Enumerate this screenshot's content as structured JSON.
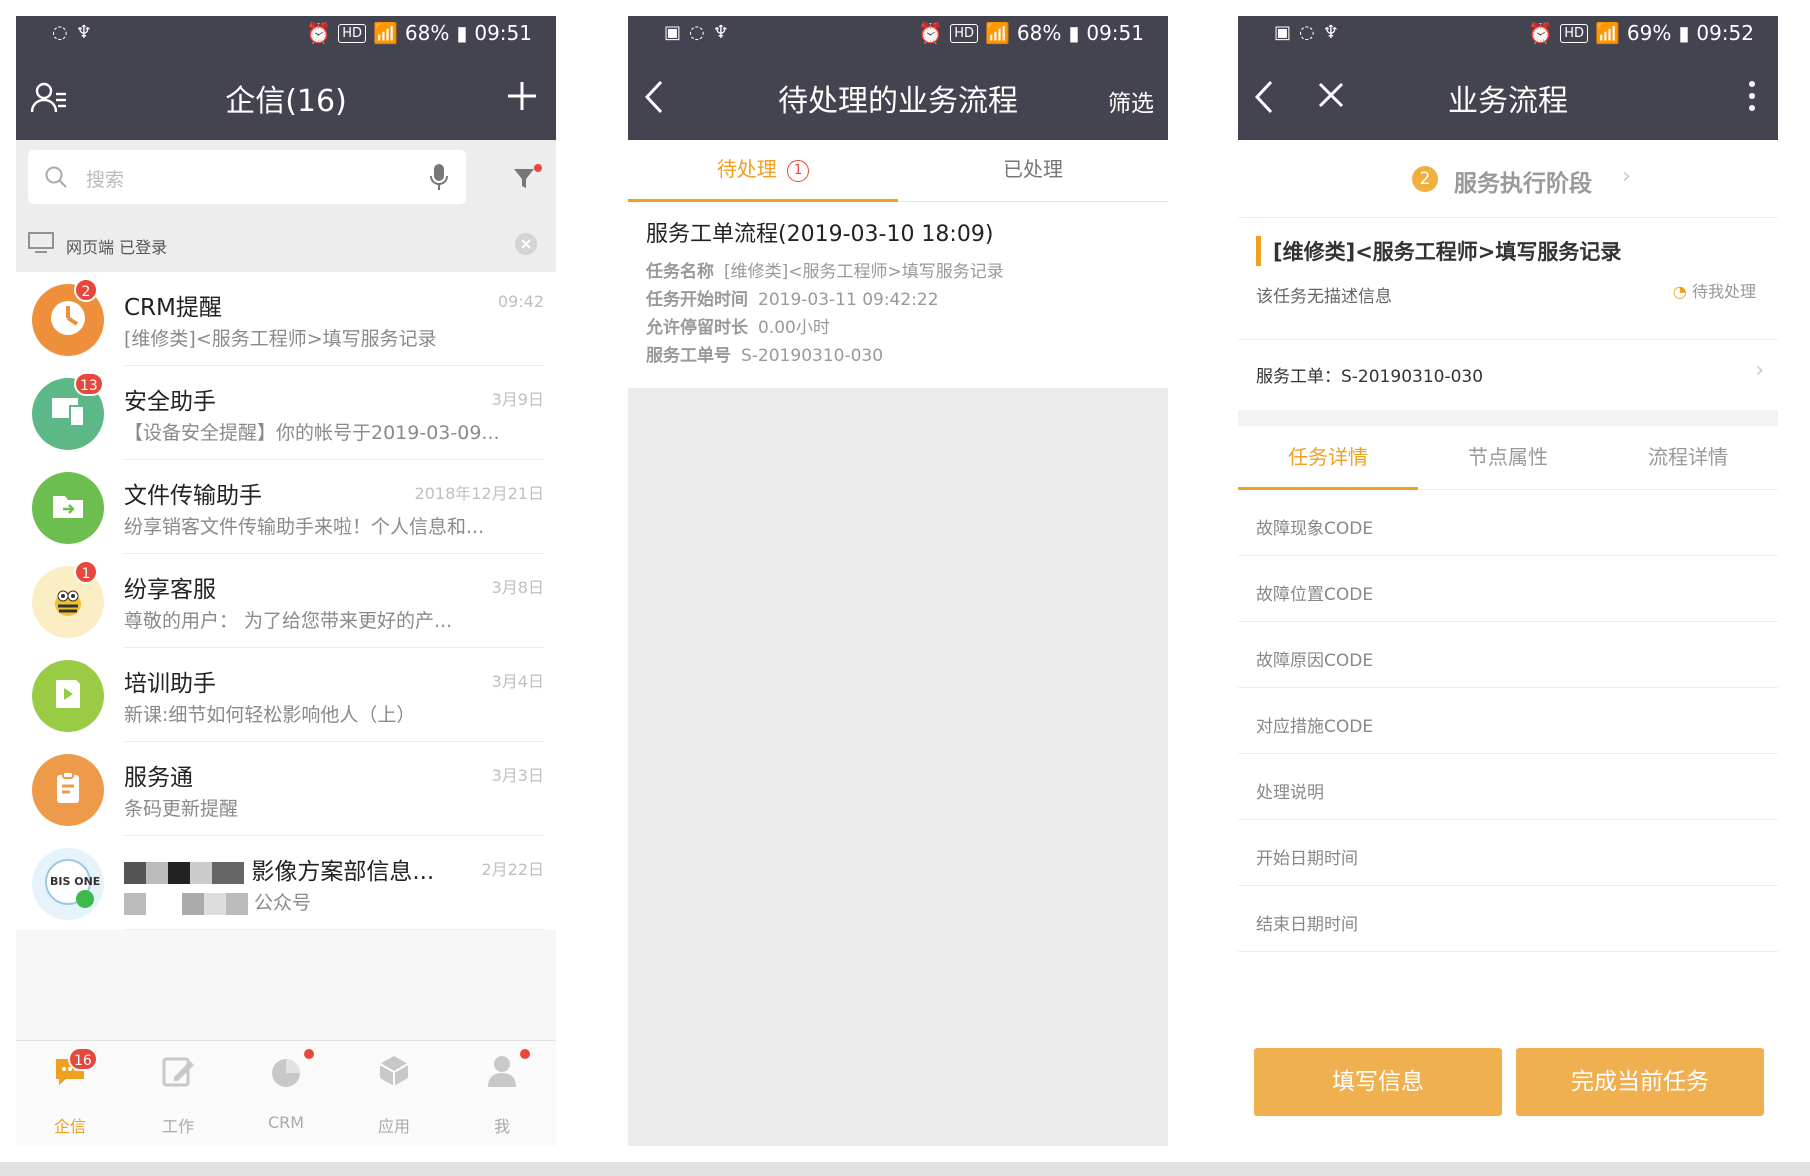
{
  "status_bars": [
    {
      "battery": "68%",
      "time": "09:51",
      "hd": "HD"
    },
    {
      "battery": "68%",
      "time": "09:51",
      "hd": "HD"
    },
    {
      "battery": "69%",
      "time": "09:52",
      "hd": "HD"
    }
  ],
  "screen1": {
    "title": "企信(16)",
    "search_placeholder": "搜索",
    "web_login": "网页端 已登录",
    "chats": [
      {
        "name": "CRM提醒",
        "time": "09:42",
        "preview": "[维修类]<服务工程师>填写服务记录",
        "badge": "2",
        "icon": "clock-icon",
        "color": "#ee8f3b"
      },
      {
        "name": "安全助手",
        "time": "3月9日",
        "preview": "【设备安全提醒】你的帐号于2019-03-09...",
        "badge": "13",
        "icon": "device-icon",
        "color": "#5cb886"
      },
      {
        "name": "文件传输助手",
        "time": "2018年12月21日",
        "preview": "纷享销客文件传输助手来啦！个人信息和...",
        "badge": "",
        "icon": "folder-icon",
        "color": "#6cbf4e"
      },
      {
        "name": "纷享客服",
        "time": "3月8日",
        "preview": "尊敬的用户：      为了给您带来更好的产...",
        "badge": "1",
        "icon": "bee-icon",
        "color": "#fbeec5"
      },
      {
        "name": "培训助手",
        "time": "3月4日",
        "preview": "新课:细节如何轻松影响他人（上）",
        "badge": "",
        "icon": "book-icon",
        "color": "#9acb45"
      },
      {
        "name": "服务通",
        "time": "3月3日",
        "preview": "条码更新提醒",
        "badge": "",
        "icon": "clipboard-icon",
        "color": "#ee9a4b"
      },
      {
        "name": "影像方案部信息...",
        "time": "2月22日",
        "preview": "公众号",
        "badge": "",
        "icon": "bis-one-logo",
        "color": "#e6f3fb"
      }
    ],
    "tabs": [
      {
        "label": "企信",
        "badge": "16",
        "icon": "chat-bubble-icon"
      },
      {
        "label": "工作",
        "badge": "",
        "icon": "pencil-icon"
      },
      {
        "label": "CRM",
        "badge": "dot",
        "icon": "pie-chart-icon"
      },
      {
        "label": "应用",
        "badge": "",
        "icon": "cube-icon"
      },
      {
        "label": "我",
        "badge": "dot",
        "icon": "person-icon"
      }
    ]
  },
  "screen2": {
    "title": "待处理的业务流程",
    "filter": "筛选",
    "seg_pending": "待处理",
    "seg_pending_count": "1",
    "seg_done": "已处理",
    "card": {
      "title": "服务工单流程(2019-03-10 18:09)",
      "rows": [
        {
          "label": "任务名称",
          "value": "[维修类]<服务工程师>填写服务记录"
        },
        {
          "label": "任务开始时间",
          "value": "2019-03-11 09:42:22"
        },
        {
          "label": "允许停留时长",
          "value": "0.00小时"
        },
        {
          "label": "服务工单号",
          "value": "S-20190310-030"
        }
      ]
    }
  },
  "screen3": {
    "title": "业务流程",
    "stage_num": "2",
    "stage_label": "服务执行阶段",
    "task_title": "[维修类]<服务工程师>填写服务记录",
    "task_desc": "该任务无描述信息",
    "task_status": "待我处理",
    "order": "服务工单：S-20190310-030",
    "tabs": [
      "任务详情",
      "节点属性",
      "流程详情"
    ],
    "fields": [
      "故障现象CODE",
      "故障位置CODE",
      "故障原因CODE",
      "对应措施CODE",
      "处理说明",
      "开始日期时间",
      "结束日期时间"
    ],
    "btn_fill": "填写信息",
    "btn_complete": "完成当前任务"
  },
  "colors": {
    "navbar": "#434450",
    "accent": "#f0a020",
    "button": "#f0b050",
    "badge": "#e8473c"
  }
}
